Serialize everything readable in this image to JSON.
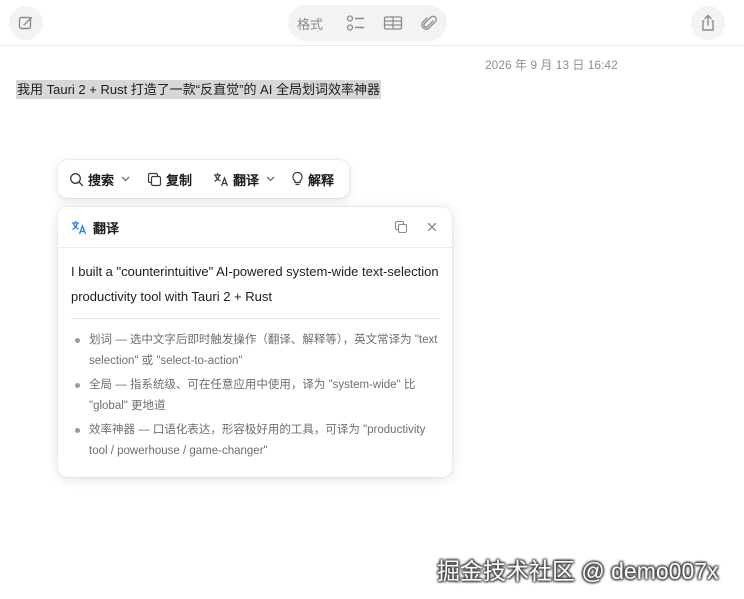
{
  "toolbar": {
    "compose_icon": "compose-icon",
    "format_label": "格式",
    "checklist_icon": "checklist-icon",
    "table_icon": "table-icon",
    "attachment_icon": "paperclip-icon",
    "share_icon": "share-icon"
  },
  "note": {
    "timestamp": "2026 年 9 月 13 日 16:42",
    "selected_text": "我用 Tauri 2 + Rust 打造了一款“反直觉”的 AI 全局划词效率神器"
  },
  "action_bar": {
    "search": "搜索",
    "copy": "复制",
    "translate": "翻译",
    "explain": "解释"
  },
  "panel": {
    "title": "翻译",
    "result": "I built a \"counterintuitive\" AI-powered system-wide text-selection productivity tool with Tauri 2 + Rust",
    "notes": [
      "划词 — 选中文字后即时触发操作（翻译、解释等），英文常译为 \"text selection\" 或 \"select-to-action\"",
      "全局 — 指系统级、可在任意应用中使用，译为 \"system-wide\" 比 \"global\" 更地道",
      "效率神器 — 口语化表达，形容极好用的工具，可译为 \"productivity tool / powerhouse / game-changer\""
    ]
  },
  "watermark": "掘金技术社区 @ demo007x",
  "colors": {
    "accent_blue": "#2f7bf5",
    "selection": "#d7d7d7"
  }
}
